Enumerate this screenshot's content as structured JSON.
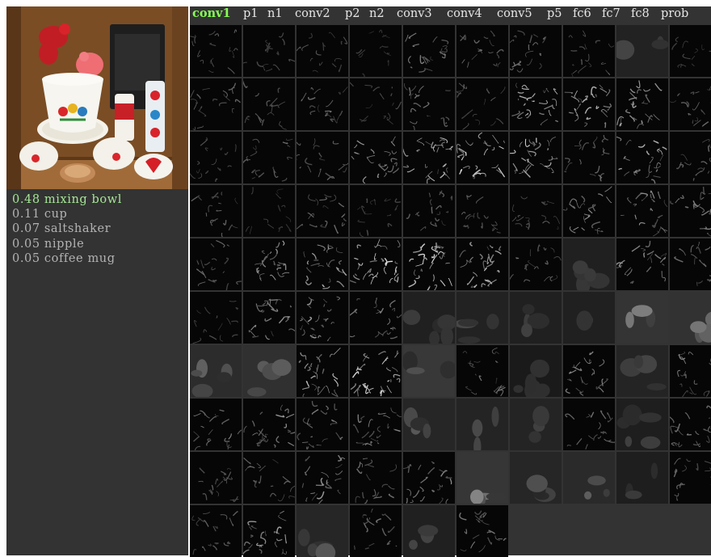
{
  "layer_tabs": [
    {
      "label": "conv1",
      "active": true
    },
    {
      "label": "p1",
      "active": false
    },
    {
      "label": "n1",
      "active": false
    },
    {
      "label": "conv2",
      "active": false
    },
    {
      "label": "p2",
      "active": false
    },
    {
      "label": "n2",
      "active": false
    },
    {
      "label": "conv3",
      "active": false
    },
    {
      "label": "conv4",
      "active": false
    },
    {
      "label": "conv5",
      "active": false
    },
    {
      "label": "p5",
      "active": false
    },
    {
      "label": "fc6",
      "active": false
    },
    {
      "label": "fc7",
      "active": false
    },
    {
      "label": "fc8",
      "active": false
    },
    {
      "label": "prob",
      "active": false
    }
  ],
  "predictions": [
    {
      "text": "0.48 mixing bowl",
      "color": "#a5e695"
    },
    {
      "text": "0.11 cup",
      "color": "#b3b3b3"
    },
    {
      "text": "0.07 saltshaker",
      "color": "#b3b3b3"
    },
    {
      "text": "0.05 nipple",
      "color": "#b3b3b3"
    },
    {
      "text": "0.05 coffee mug",
      "color": "#b3b3b3"
    }
  ],
  "colors": {
    "background": "#333333",
    "active_tab": "#88ff55",
    "tab": "#e6e6e6",
    "top_prediction": "#a5e695",
    "prediction": "#b3b3b3"
  },
  "feature_maps": {
    "count": 96,
    "columns": 10,
    "brightness": [
      0.3,
      0.2,
      0.25,
      0.15,
      0.45,
      0.35,
      0.4,
      0.3,
      0.3,
      0.15,
      0.35,
      0.3,
      0.35,
      0.2,
      0.4,
      0.3,
      0.85,
      0.75,
      0.65,
      0.35,
      0.25,
      0.35,
      0.3,
      0.6,
      0.75,
      0.9,
      0.85,
      0.4,
      0.7,
      0.35,
      0.3,
      0.15,
      0.35,
      0.2,
      0.35,
      0.3,
      0.3,
      0.55,
      0.55,
      0.5,
      0.35,
      0.65,
      0.7,
      1.0,
      0.95,
      0.75,
      0.35,
      0.25,
      0.55,
      0.35,
      0.2,
      0.55,
      0.6,
      0.45,
      0.25,
      0.3,
      0.25,
      0.25,
      0.75,
      0.7,
      0.55,
      0.65,
      0.8,
      0.9,
      0.85,
      0.4,
      0.1,
      0.5,
      0.35,
      0.45,
      0.45,
      0.6,
      0.45,
      0.5,
      0.4,
      0.35,
      0.35,
      0.4,
      0.2,
      0.45,
      0.3,
      0.3,
      0.55,
      0.35,
      0.55,
      0.8,
      0.4,
      0.5,
      0.2,
      0.4,
      0.35,
      0.6,
      0.4,
      0.4,
      0.25,
      0.45
    ],
    "style": [
      "edge",
      "edge",
      "edge",
      "edge",
      "edge",
      "edge",
      "edge",
      "edge",
      "blob",
      "edge",
      "edge",
      "edge",
      "edge",
      "edge",
      "edge",
      "edge",
      "edge",
      "edge",
      "edge",
      "edge",
      "edge",
      "edge",
      "edge",
      "edge",
      "edge",
      "edge",
      "edge",
      "edge",
      "edge",
      "edge",
      "edge",
      "edge",
      "edge",
      "edge",
      "edge",
      "edge",
      "edge",
      "edge",
      "edge",
      "edge",
      "edge",
      "edge",
      "edge",
      "edge",
      "edge",
      "edge",
      "edge",
      "blob",
      "edge",
      "edge",
      "edge",
      "edge",
      "edge",
      "edge",
      "blob",
      "blob",
      "blob",
      "blob",
      "blob",
      "blob",
      "blob",
      "blob",
      "edge",
      "edge",
      "blob",
      "edge",
      "blob",
      "edge",
      "blob",
      "edge",
      "edge",
      "edge",
      "edge",
      "edge",
      "blob",
      "blob",
      "blob",
      "edge",
      "blob",
      "edge",
      "edge",
      "edge",
      "edge",
      "edge",
      "edge",
      "blob",
      "blob",
      "blob",
      "blob",
      "edge",
      "edge",
      "edge",
      "blob",
      "edge",
      "blob",
      "edge"
    ]
  }
}
